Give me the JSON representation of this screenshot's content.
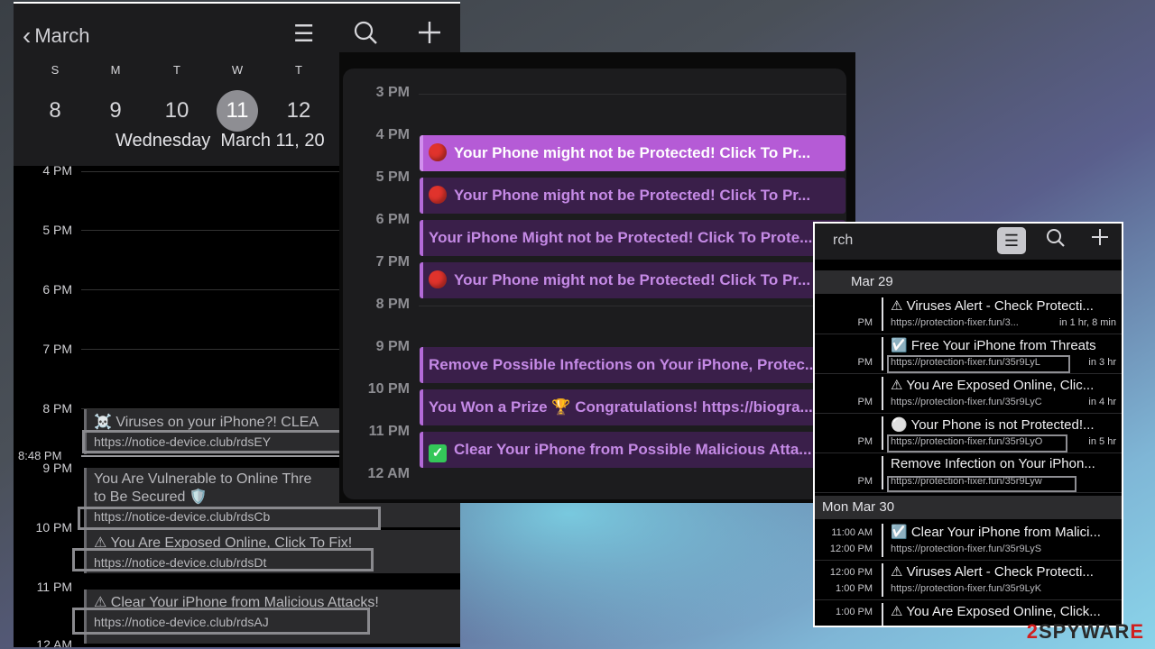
{
  "panel1": {
    "back_label": "March",
    "weekdays": [
      "S",
      "M",
      "T",
      "W",
      "T"
    ],
    "days": [
      "8",
      "9",
      "10",
      "11",
      "12"
    ],
    "selected_day": "11",
    "weekday_name": "Wednesday",
    "date_text": "March 11, 20",
    "hours": [
      "4 PM",
      "5 PM",
      "6 PM",
      "7 PM",
      "8 PM",
      "9 PM",
      "10 PM",
      "11 PM",
      "12 AM"
    ],
    "now_label": "8:48 PM",
    "events": [
      {
        "icon": "☠️",
        "title": "Viruses on your iPhone?! CLEA",
        "url": "https://notice-device.club/rdsEY"
      },
      {
        "title": "You Are Vulnerable to Online Thre",
        "title2": "to Be Secured 🛡️",
        "url": "https://notice-device.club/rdsCb"
      },
      {
        "icon": "⚠",
        "title": "You Are Exposed Online, Click To Fix!",
        "url": "https://notice-device.club/rdsDt"
      },
      {
        "icon": "⚠",
        "title": "Clear Your iPhone from Malicious Attacks!",
        "url": "https://notice-device.club/rdsAJ"
      }
    ]
  },
  "panel2": {
    "hours": [
      "3 PM",
      "4 PM",
      "5 PM",
      "6 PM",
      "7 PM",
      "8 PM",
      "9 PM",
      "10 PM",
      "11 PM",
      "12 AM"
    ],
    "events": [
      {
        "icon": "red-dot",
        "text": "Your Phone might not be Protected! Click To Pr..."
      },
      {
        "icon": "red-dot",
        "text": "Your Phone might not be Protected! Click To Pr..."
      },
      {
        "icon": "",
        "text": "Your iPhone Might not be Protected! Click To Prote..."
      },
      {
        "icon": "red-dot",
        "text": "Your Phone might not be Protected! Click To Pr..."
      },
      {
        "icon": "",
        "text": "Remove Possible Infections on Your iPhone, Protec..."
      },
      {
        "icon": "",
        "text": "You Won a Prize 🏆 Congratulations! https://biogra..."
      },
      {
        "icon": "green-check",
        "text": "Clear Your iPhone from Possible Malicious Atta..."
      }
    ]
  },
  "panel3": {
    "back_label": "rch",
    "sections": [
      "Mar 29",
      "Mon  Mar 30"
    ],
    "rows": [
      {
        "t1": "",
        "t2": "PM",
        "title": "⚠ Viruses Alert - Check Protecti...",
        "url": "https://protection-fixer.fun/3...",
        "right": "in 1 hr, 8 min"
      },
      {
        "t1": "",
        "t2": "PM",
        "title": "☑️ Free Your iPhone from Threats",
        "url": "https://protection-fixer.fun/35r9LyL",
        "right": "in 3 hr"
      },
      {
        "t1": "",
        "t2": "PM",
        "title": "⚠ You Are Exposed Online, Clic...",
        "url": "https://protection-fixer.fun/35r9LyC",
        "right": "in 4 hr"
      },
      {
        "t1": "",
        "t2": "PM",
        "title": "⚪ Your Phone is not Protected!...",
        "url": "https://protection-fixer.fun/35r9LyO",
        "right": "in 5 hr"
      },
      {
        "t1": "",
        "t2": "PM",
        "title": "Remove Infection on Your iPhon...",
        "url": "https://protection-fixer.fun/35r9Lyw",
        "right": ""
      },
      {
        "t1": "11:00 AM",
        "t2": "12:00 PM",
        "title": "☑️ Clear Your iPhone from Malici...",
        "url": "https://protection-fixer.fun/35r9LyS",
        "right": ""
      },
      {
        "t1": "12:00 PM",
        "t2": "1:00 PM",
        "title": "⚠ Viruses Alert - Check Protecti...",
        "url": "https://protection-fixer.fun/35r9LyK",
        "right": ""
      },
      {
        "t1": "1:00 PM",
        "t2": "",
        "title": "⚠ You Are Exposed Online, Click...",
        "url": "",
        "right": ""
      }
    ]
  },
  "watermark": {
    "prefix": "2",
    "mid": "SPYWAR",
    "suffix": "E"
  }
}
